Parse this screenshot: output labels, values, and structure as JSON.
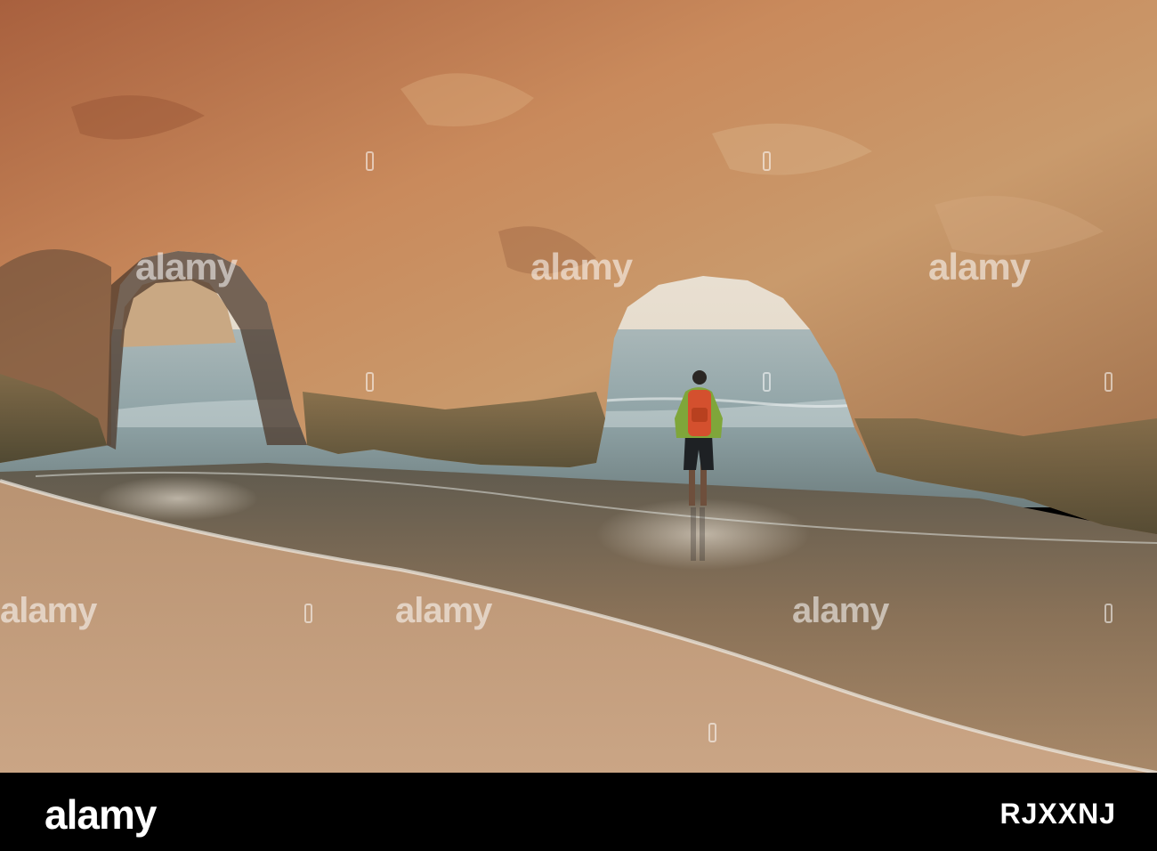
{
  "watermark": {
    "text": "alamy"
  },
  "footer": {
    "logo": "alamy",
    "image_id": "RJXXNJ"
  },
  "colors": {
    "rock": "#b9774f",
    "sand": "#c8a27f",
    "sea": "#9eb0b4",
    "sky": "#efe7da",
    "backpack": "#d4502e",
    "jacket": "#7fa63a"
  }
}
